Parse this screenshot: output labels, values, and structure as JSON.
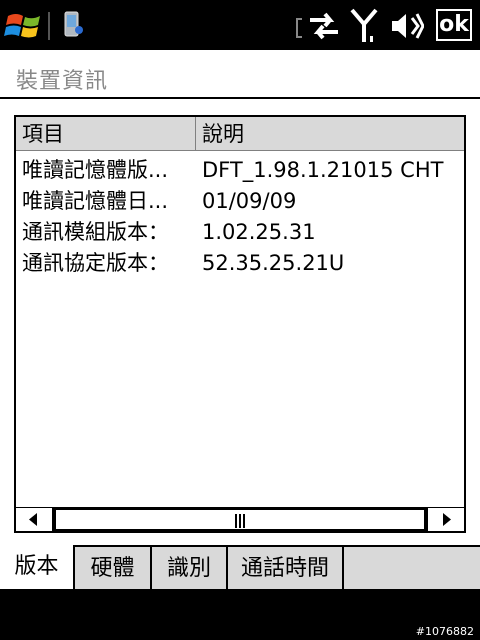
{
  "status_bar": {
    "ok_label": "ok",
    "icons": [
      "windows-start-icon",
      "device-info-app-icon",
      "data-sync-icon",
      "signal-strength-icon",
      "sound-muted-icon"
    ]
  },
  "page": {
    "title": "裝置資訊"
  },
  "table": {
    "columns": [
      "項目",
      "說明"
    ],
    "rows": [
      [
        "唯讀記憶體版...",
        "DFT_1.98.1.21015 CHT"
      ],
      [
        "唯讀記憶體日...",
        "01/09/09"
      ],
      [
        "通訊模組版本：",
        "1.02.25.31"
      ],
      [
        "通訊協定版本：",
        "52.35.25.21U"
      ]
    ]
  },
  "tabs": [
    {
      "label": "版本",
      "active": true
    },
    {
      "label": "硬體",
      "active": false
    },
    {
      "label": "識別",
      "active": false
    },
    {
      "label": "通話時間",
      "active": false
    }
  ],
  "watermark": "#1076882",
  "colors": {
    "title_gray": "#888888",
    "header_bg": "#d9d9d9",
    "tab_bg": "#d9d9d9"
  }
}
